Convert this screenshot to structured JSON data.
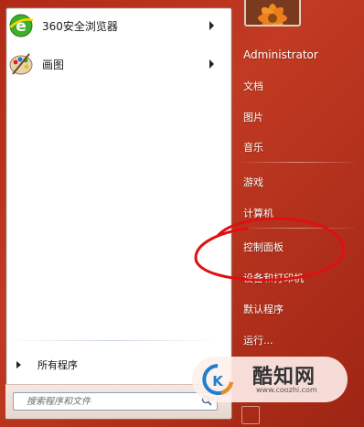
{
  "left_pane": {
    "pinned": [
      {
        "label": "360安全浏览器",
        "icon": "browser-360-icon",
        "has_submenu": true
      },
      {
        "label": "画图",
        "icon": "paint-palette-icon",
        "has_submenu": true
      }
    ],
    "all_programs_label": "所有程序",
    "search_placeholder": "搜索程序和文件"
  },
  "right_pane": {
    "user_name": "Administrator",
    "items": [
      {
        "label": "文档"
      },
      {
        "label": "图片"
      },
      {
        "label": "音乐"
      },
      {
        "label": "游戏"
      },
      {
        "label": "计算机"
      },
      {
        "label": "控制面板"
      },
      {
        "label": "设备和打印机"
      },
      {
        "label": "默认程序"
      },
      {
        "label": "运行..."
      }
    ]
  },
  "watermark": {
    "title": "酷知网",
    "url": "www.coozhi.com"
  },
  "colors": {
    "accent": "#c23a22",
    "annotation": "#e01010",
    "menu_bg": "#ffffff"
  }
}
